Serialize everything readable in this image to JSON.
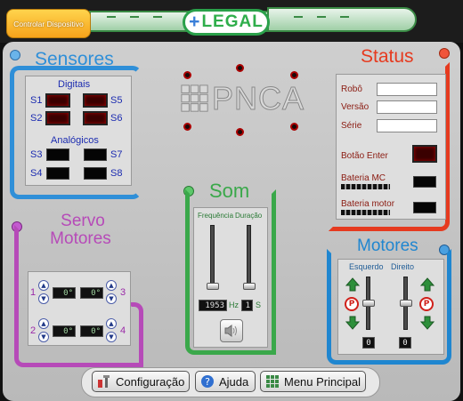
{
  "topbar": {
    "control_button": "Controlar Dispositivo",
    "logo": "LEGAL",
    "logo_plus": "+"
  },
  "center_logo": "PNCA",
  "sensors": {
    "title": "Sensores",
    "digital_label": "Digitais",
    "digital": [
      "S1",
      "S5",
      "S2",
      "S6"
    ],
    "analog_label": "Analógicos",
    "analog": [
      "S3",
      "S7",
      "S4",
      "S8"
    ]
  },
  "status": {
    "title": "Status",
    "fields": [
      "Robô",
      "Versão",
      "Série"
    ],
    "enter_button": "Botão Enter",
    "battery_mc": "Bateria MC",
    "battery_motor": "Bateria motor"
  },
  "servo": {
    "title_line1": "Servo",
    "title_line2": "Motores",
    "servos": [
      {
        "label": "1",
        "value": "0°"
      },
      {
        "label": "3",
        "value": "0°"
      },
      {
        "label": "2",
        "value": "0°"
      },
      {
        "label": "4",
        "value": "0°"
      }
    ]
  },
  "sound": {
    "title": "Som",
    "freq_label": "Frequência",
    "dur_label": "Duração",
    "freq_value": "1953",
    "freq_unit": "Hz",
    "dur_value": "1",
    "dur_unit": "S"
  },
  "motors": {
    "title": "Motores",
    "left_label": "Esquerdo",
    "right_label": "Direito",
    "left_value": "0",
    "right_value": "0",
    "brake": "P"
  },
  "bottom": {
    "config": "Configuração",
    "help": "Ajuda",
    "menu": "Menu Principal"
  },
  "colors": {
    "sensors": "#2f8fd8",
    "status": "#e63a1f",
    "servo": "#b64ab8",
    "sound": "#3aa84a",
    "motors": "#1f86d0"
  }
}
